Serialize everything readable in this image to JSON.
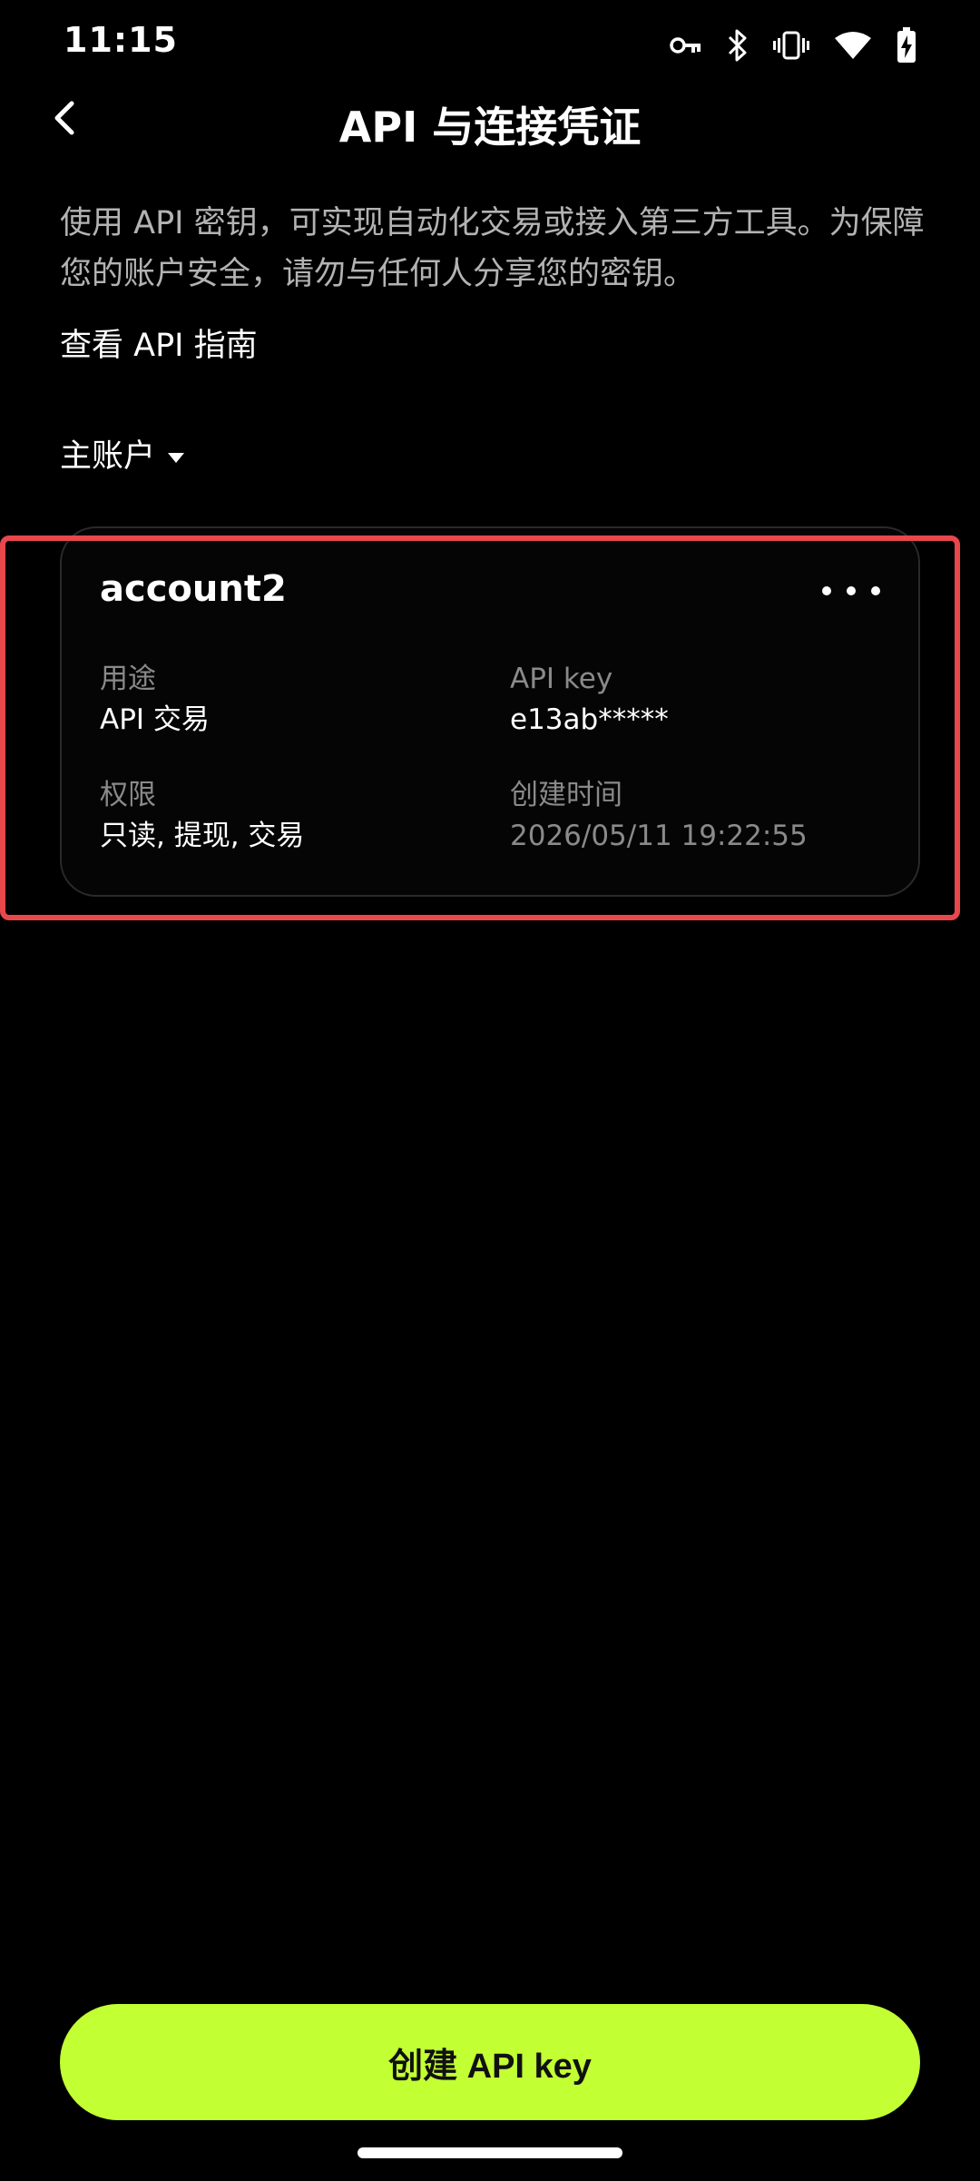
{
  "status_bar": {
    "time": "11:15",
    "icons": [
      "vpn-key-icon",
      "bluetooth-icon",
      "vibrate-icon",
      "wifi-icon",
      "battery-charging-icon"
    ]
  },
  "header": {
    "title": "API 与连接凭证",
    "back_icon": "chevron-left-icon"
  },
  "description": "使用 API 密钥，可实现自动化交易或接入第三方工具。为保障您的账户安全，请勿与任何人分享您的密钥。",
  "guide_link": "查看 API 指南",
  "account_selector": {
    "label": "主账户",
    "icon": "caret-down-icon"
  },
  "api_card": {
    "name": "account2",
    "more_icon": "more-horizontal-icon",
    "purpose_label": "用途",
    "purpose_value": "API 交易",
    "api_key_label": "API key",
    "api_key_value": "e13ab*****",
    "permissions_label": "权限",
    "permissions_value": "只读, 提现, 交易",
    "created_label": "创建时间",
    "created_value": "2026/05/11 19:22:55"
  },
  "create_button": {
    "label": "创建 API key"
  },
  "colors": {
    "background": "#000000",
    "accent": "#c2ff33",
    "highlight": "#e8474c",
    "muted_text": "#8a8a8a"
  }
}
